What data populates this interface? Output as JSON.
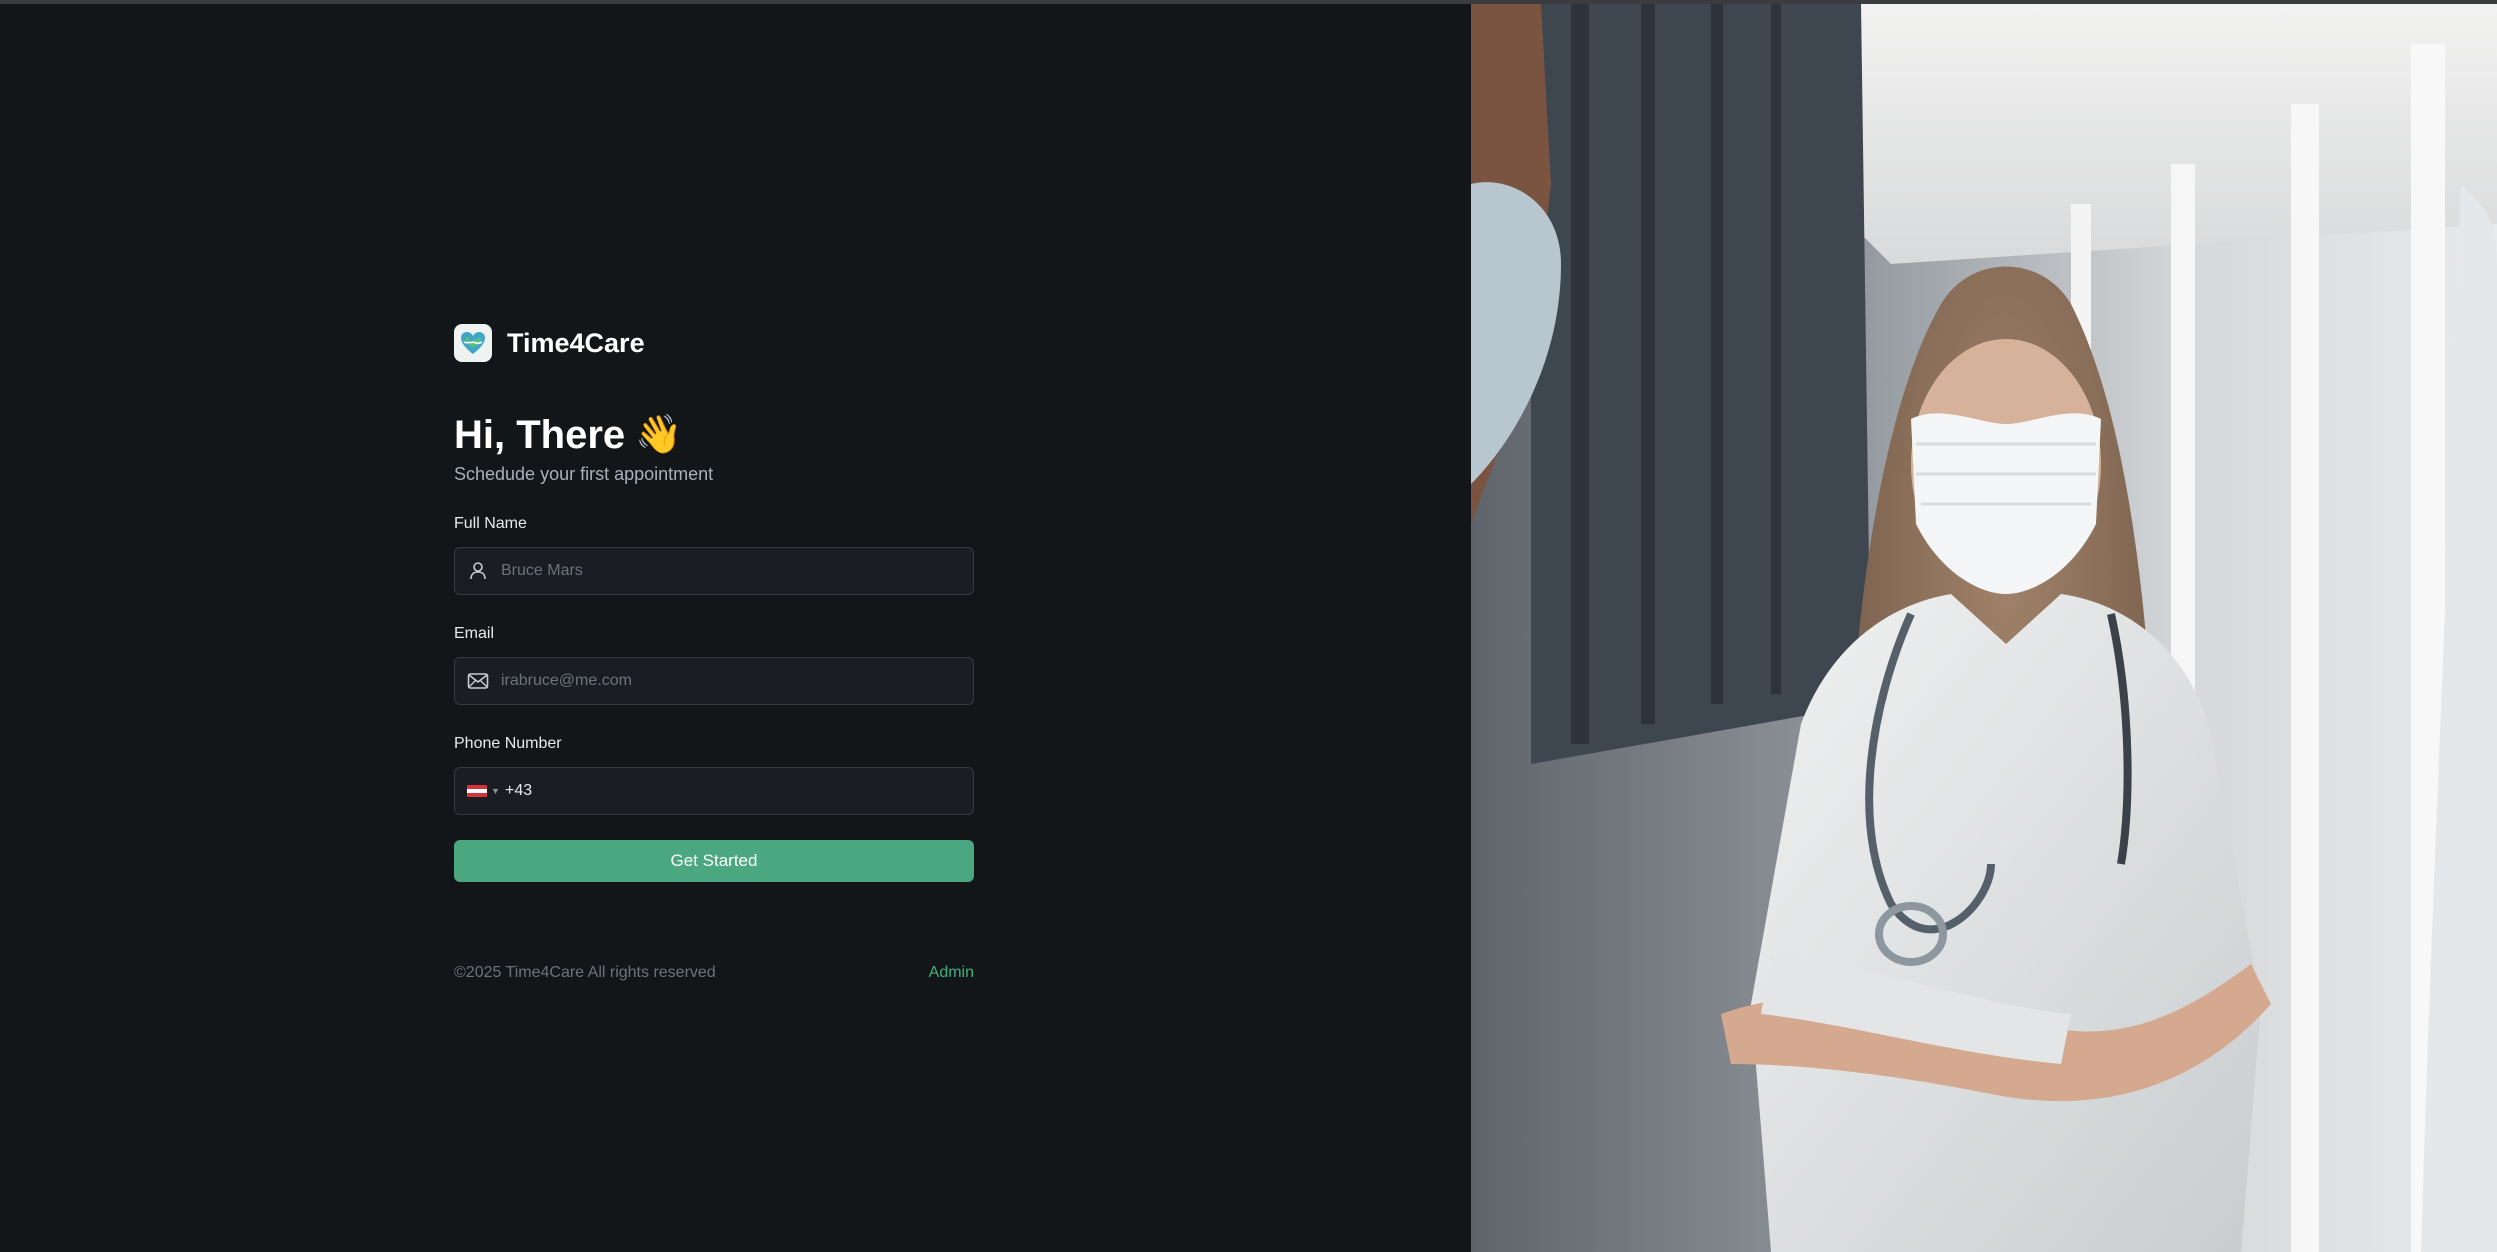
{
  "brand": {
    "name": "Time4Care",
    "logo_icon": "heart-globe-icon"
  },
  "greeting": {
    "title": "Hi, There",
    "emoji": "👋",
    "subtitle": "Schedude your first appointment"
  },
  "form": {
    "full_name": {
      "label": "Full Name",
      "placeholder": "Bruce Mars",
      "icon": "user-icon"
    },
    "email": {
      "label": "Email",
      "placeholder": "irabruce@me.com",
      "icon": "mail-icon"
    },
    "phone": {
      "label": "Phone Number",
      "value": "+43",
      "flag": "austria-flag-icon"
    },
    "submit_label": "Get Started"
  },
  "footer": {
    "copyright": "©2025 Time4Care All rights reserved",
    "admin_link": "Admin"
  },
  "colors": {
    "background": "#131619",
    "accent": "#4aa77f",
    "link": "#3fb07e"
  }
}
